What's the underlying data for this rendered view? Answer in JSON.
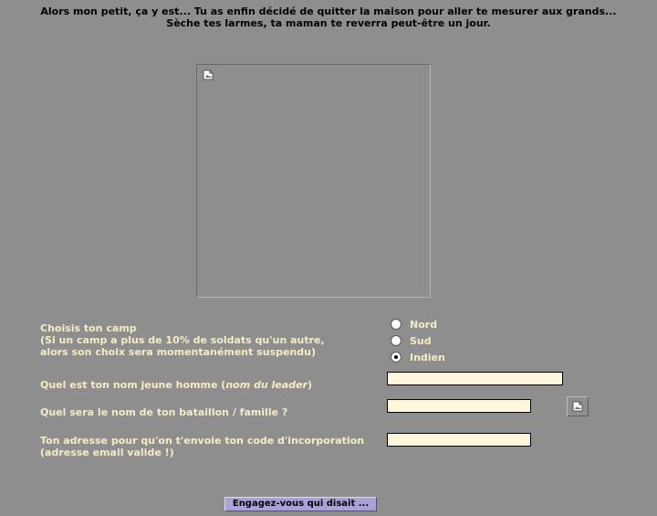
{
  "intro": {
    "line1": "Alors mon petit, ça y est... Tu as enfin décidé de quitter la maison pour aller te mesurer aux grands...",
    "line2": "Sèche tes larmes, ta maman te reverra peut-être un jour."
  },
  "camp": {
    "title": "Choisis ton camp",
    "note1": "(Si un camp a plus de 10% de soldats qu'un autre,",
    "note2": "alors son choix sera momentanément suspendu)",
    "options": [
      {
        "label": "Nord",
        "checked": false
      },
      {
        "label": "Sud",
        "checked": false
      },
      {
        "label": "Indien",
        "checked": true
      }
    ]
  },
  "leader": {
    "label_main": "Quel est ton nom jeune homme (",
    "label_em": "nom du leader",
    "label_end": ")",
    "value": ""
  },
  "battalion": {
    "label": "Quel sera le nom de ton bataillon / famille ?",
    "value": ""
  },
  "email": {
    "label1": "Ton adresse pour qu'on t'envoie ton code d'incorporation",
    "label2": "(adresse email valide !)",
    "value": ""
  },
  "submit_label": "Engagez-vous qui disait ...",
  "icons": {
    "broken_image": "broken-image-icon"
  },
  "colors": {
    "background": "#8e8e8e",
    "label": "#f6ecc4",
    "input_bg": "#fff7dc",
    "button": "#a9a2d8"
  }
}
